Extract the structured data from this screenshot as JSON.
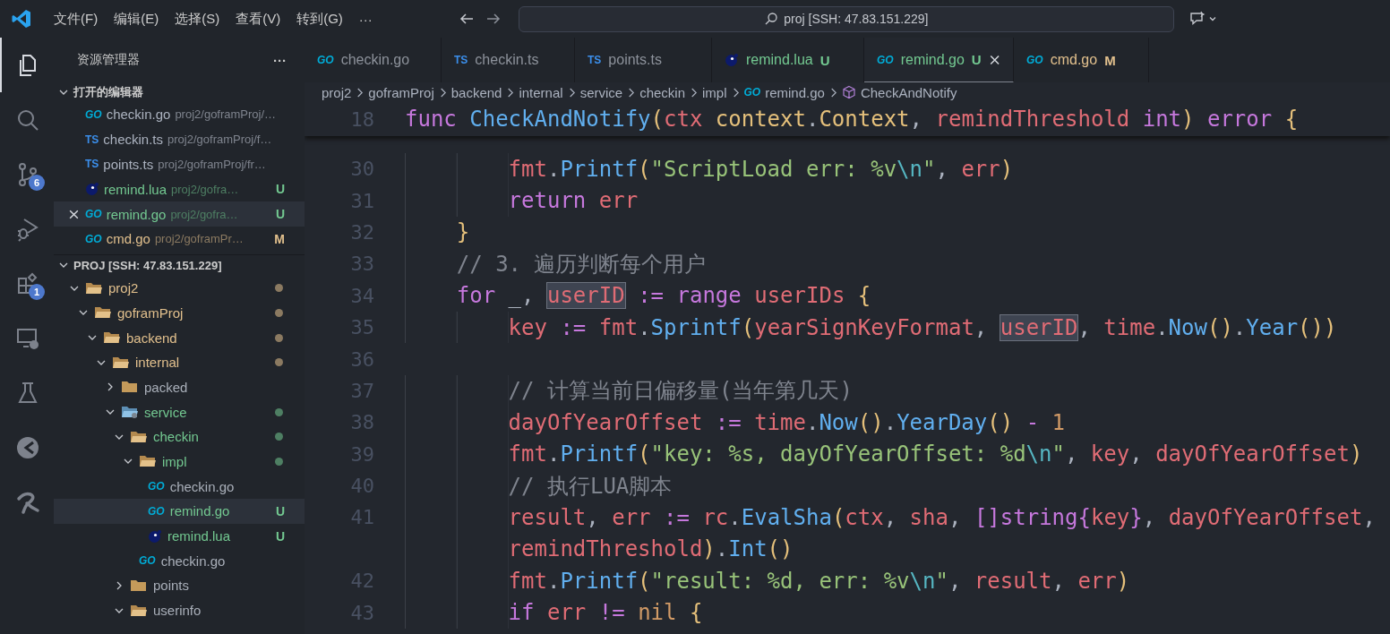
{
  "title_bar": {
    "menus": [
      "文件(F)",
      "编辑(E)",
      "选择(S)",
      "查看(V)",
      "转到(G)"
    ],
    "more": "···",
    "search": "proj [SSH: 47.83.151.229]"
  },
  "activity_bar": [
    {
      "kind": "explorer",
      "selected": true
    },
    {
      "kind": "search",
      "selected": false
    },
    {
      "kind": "source-control",
      "selected": false,
      "badge": "6"
    },
    {
      "kind": "run-debug",
      "selected": false
    },
    {
      "kind": "extensions",
      "selected": false,
      "badge": "1"
    },
    {
      "kind": "remote",
      "selected": false
    },
    {
      "kind": "testing",
      "selected": false
    },
    {
      "kind": "dial",
      "selected": false
    },
    {
      "kind": "swirl",
      "selected": false
    }
  ],
  "sidebar": {
    "title": "资源管理器",
    "more": "···",
    "open_editors": {
      "title": "打开的编辑器",
      "expanded": true,
      "items": [
        {
          "kind": "go",
          "icon_label": "GO",
          "name": "checkin.go",
          "path": "proj2/goframProj/…",
          "selected": false
        },
        {
          "kind": "ts",
          "icon_label": "TS",
          "name": "checkin.ts",
          "path": "proj2/goframProj/f…",
          "selected": false
        },
        {
          "kind": "ts",
          "icon_label": "TS",
          "name": "points.ts",
          "path": "proj2/goframProj/fr…",
          "selected": false
        },
        {
          "kind": "lua",
          "name": "remind.lua",
          "path": "proj2/gofra…",
          "color": "#73c991",
          "badge": "U",
          "selected": false
        },
        {
          "kind": "go",
          "icon_label": "GO",
          "name": "remind.go",
          "path": "proj2/gofra…",
          "color": "#73c991",
          "badge": "U",
          "selected": true
        },
        {
          "kind": "go",
          "icon_label": "GO",
          "name": "cmd.go",
          "path": "proj2/goframPr…",
          "color": "#e2c08d",
          "badge": "M",
          "selected": false
        }
      ]
    },
    "folder": {
      "title": "PROJ [SSH: 47.83.151.229]",
      "expanded": true,
      "tree": [
        {
          "name": "proj2",
          "kind": "folder",
          "expanded": true,
          "color": "#e2c08d",
          "dot": true,
          "selected": false,
          "children": [
            {
              "name": "goframProj",
              "kind": "folder",
              "expanded": true,
              "color": "#e2c08d",
              "dot": true,
              "selected": false,
              "children": [
                {
                  "name": "backend",
                  "kind": "folder",
                  "expanded": true,
                  "color": "#e2c08d",
                  "dot": true,
                  "selected": false,
                  "children": [
                    {
                      "name": "internal",
                      "kind": "folder",
                      "expanded": true,
                      "color": "#e2c08d",
                      "dot": true,
                      "selected": false,
                      "children": [
                        {
                          "name": "packed",
                          "kind": "folder",
                          "expanded": false,
                          "selected": false
                        },
                        {
                          "name": "service",
                          "kind": "folder-gear",
                          "expanded": true,
                          "color": "#73c991",
                          "dot": true,
                          "selected": false,
                          "children": [
                            {
                              "name": "checkin",
                              "kind": "folder",
                              "expanded": true,
                              "color": "#73c991",
                              "dot": true,
                              "selected": false,
                              "children": [
                                {
                                  "name": "impl",
                                  "kind": "folder",
                                  "expanded": true,
                                  "color": "#73c991",
                                  "dot": true,
                                  "selected": false,
                                  "children": [
                                    {
                                      "name": "checkin.go",
                                      "kind": "go",
                                      "icon_label": "GO",
                                      "selected": false
                                    },
                                    {
                                      "name": "remind.go",
                                      "kind": "go",
                                      "icon_label": "GO",
                                      "color": "#73c991",
                                      "badge": "U",
                                      "selected": true
                                    },
                                    {
                                      "name": "remind.lua",
                                      "kind": "lua",
                                      "color": "#73c991",
                                      "badge": "U",
                                      "selected": false
                                    }
                                  ]
                                },
                                {
                                  "name": "checkin.go",
                                  "kind": "go",
                                  "icon_label": "GO",
                                  "selected": false
                                }
                              ]
                            },
                            {
                              "name": "points",
                              "kind": "folder",
                              "expanded": false,
                              "selected": false
                            },
                            {
                              "name": "userinfo",
                              "kind": "folder",
                              "expanded": true,
                              "selected": false
                            }
                          ]
                        }
                      ]
                    }
                  ]
                }
              ]
            }
          ]
        }
      ]
    }
  },
  "tabs": [
    {
      "kind": "go",
      "icon_label": "GO",
      "label": "checkin.go",
      "selected": false
    },
    {
      "kind": "ts",
      "icon_label": "TS",
      "label": "checkin.ts",
      "selected": false
    },
    {
      "kind": "ts",
      "icon_label": "TS",
      "label": "points.ts",
      "selected": false
    },
    {
      "kind": "lua",
      "label": "remind.lua",
      "color": "#73c991",
      "badge": "U",
      "selected": false
    },
    {
      "kind": "go",
      "icon_label": "GO",
      "label": "remind.go",
      "color": "#73c991",
      "badge": "U",
      "selected": true
    },
    {
      "kind": "go",
      "icon_label": "GO",
      "label": "cmd.go",
      "color": "#e2c08d",
      "badge": "M",
      "selected": false
    }
  ],
  "breadcrumbs": [
    {
      "text": "proj2"
    },
    {
      "text": "goframProj"
    },
    {
      "text": "backend"
    },
    {
      "text": "internal"
    },
    {
      "text": "service"
    },
    {
      "text": "checkin"
    },
    {
      "text": "impl"
    },
    {
      "text": "remind.go",
      "kind": "go",
      "icon_label": "GO"
    },
    {
      "text": "CheckAndNotify",
      "kind": "symbol"
    }
  ],
  "editor": {
    "sticky": {
      "number": "18",
      "pieces": [
        {
          "text": "func CheckAndNotify(ctx context.Context, remindThreshold int) error {",
          "highlighted": false
        }
      ]
    },
    "lines": [
      {
        "number": "30",
        "pieces": [
          {
            "text": "        fmt.Printf(\"ScriptLoad err: %v\\n\", err)",
            "highlighted": false
          }
        ]
      },
      {
        "number": "31",
        "pieces": [
          {
            "text": "        return err",
            "highlighted": false
          }
        ]
      },
      {
        "number": "32",
        "pieces": [
          {
            "text": "    }",
            "highlighted": false
          }
        ]
      },
      {
        "number": "33",
        "pieces": [
          {
            "text": "    // 3. 遍历判断每个用户",
            "highlighted": false
          }
        ]
      },
      {
        "number": "34",
        "pieces": [
          {
            "text": "    for _, ",
            "highlighted": false
          },
          {
            "text": "userID",
            "highlighted": true
          },
          {
            "text": " := range userIDs {",
            "highlighted": false
          }
        ]
      },
      {
        "number": "35",
        "pieces": [
          {
            "text": "        key := fmt.Sprintf(yearSignKeyFormat, ",
            "highlighted": false
          },
          {
            "text": "userID",
            "highlighted": true
          },
          {
            "text": ", time.Now().Year())",
            "highlighted": false
          }
        ]
      },
      {
        "number": "36"
      },
      {
        "number": "37",
        "pieces": [
          {
            "text": "        // 计算当前日偏移量(当年第几天)",
            "highlighted": false
          }
        ]
      },
      {
        "number": "38",
        "pieces": [
          {
            "text": "        dayOfYearOffset := time.Now().YearDay() - 1",
            "highlighted": false
          }
        ]
      },
      {
        "number": "39",
        "pieces": [
          {
            "text": "        fmt.Printf(\"key: %s, dayOfYearOffset: %d\\n\", key, dayOfYearOffset)",
            "highlighted": false
          }
        ]
      },
      {
        "number": "40",
        "pieces": [
          {
            "text": "        // 执行LUA脚本",
            "highlighted": false
          }
        ]
      },
      {
        "number": "41",
        "pieces": [
          {
            "text": "        result, err := rc.EvalSha(ctx, sha, []string{key}, dayOfYearOffset,",
            "highlighted": false
          }
        ]
      },
      {
        "pieces": [
          {
            "text": "        remindThreshold).Int()",
            "highlighted": false
          }
        ]
      },
      {
        "number": "42",
        "pieces": [
          {
            "text": "        fmt.Printf(\"result: %d, err: %v\\n\", result, err)",
            "highlighted": false
          }
        ]
      },
      {
        "number": "43",
        "pieces": [
          {
            "text": "        if err != nil {",
            "highlighted": false
          }
        ]
      }
    ]
  }
}
